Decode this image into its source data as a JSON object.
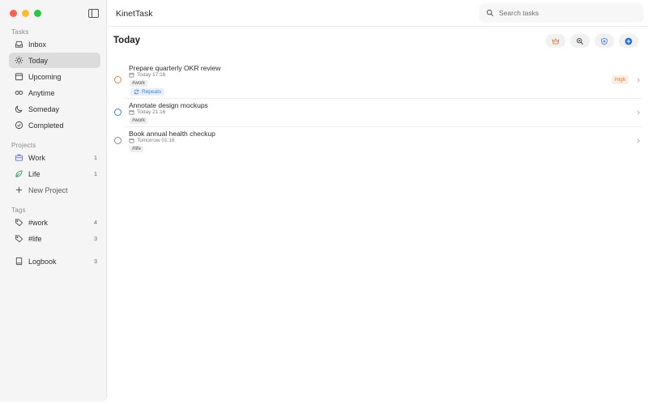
{
  "app": {
    "title": "KinetTask"
  },
  "search": {
    "placeholder": "Search tasks"
  },
  "page": {
    "title": "Today"
  },
  "sidebar": {
    "sections": {
      "tasks": "Tasks",
      "projects": "Projects",
      "tags": "Tags"
    },
    "tasks": [
      {
        "label": "Inbox",
        "icon": "inbox-icon"
      },
      {
        "label": "Today",
        "icon": "sun-icon",
        "active": true
      },
      {
        "label": "Upcoming",
        "icon": "calendar-icon"
      },
      {
        "label": "Anytime",
        "icon": "infinity-icon"
      },
      {
        "label": "Someday",
        "icon": "moon-icon"
      },
      {
        "label": "Completed",
        "icon": "check-circle-icon"
      }
    ],
    "projects": [
      {
        "label": "Work",
        "count": "1",
        "icon": "briefcase-icon",
        "color": "#6b6ed6"
      },
      {
        "label": "Life",
        "count": "1",
        "icon": "leaf-icon",
        "color": "#2e9e6e"
      }
    ],
    "new_project": "New Project",
    "tags": [
      {
        "label": "#work",
        "count": "4",
        "icon": "tag-icon"
      },
      {
        "label": "#life",
        "count": "3",
        "icon": "tag-icon"
      }
    ],
    "logbook": {
      "label": "Logbook",
      "count": "3",
      "icon": "book-icon"
    }
  },
  "toolbar": [
    {
      "name": "crown-button",
      "icon": "crown-icon",
      "color": "#e07a3a"
    },
    {
      "name": "zoom-button",
      "icon": "zoom-in-icon",
      "color": "#555555"
    },
    {
      "name": "shield-button",
      "icon": "shield-icon",
      "color": "#3f7fe0"
    },
    {
      "name": "add-task-button",
      "icon": "plus-circle-icon",
      "color": "#1f6fe5"
    }
  ],
  "tasks": [
    {
      "title": "Prepare quarterly OKR review",
      "date": "Today 17:16",
      "tag": "#work",
      "repeat": "Repeats",
      "priority": "High",
      "check_color": "#e8883a"
    },
    {
      "title": "Annotate design mockups",
      "date": "Today 21:16",
      "tag": "#work",
      "check_color": "#3f7fe0"
    },
    {
      "title": "Book annual health checkup",
      "date": "Tomorrow 01:16",
      "tag": "#life",
      "check_color": "#8a8a8a"
    }
  ],
  "colors": {
    "accent": "#1f6fe5",
    "priority_high": "#e07a3a",
    "repeat": "#3f7fe0"
  }
}
